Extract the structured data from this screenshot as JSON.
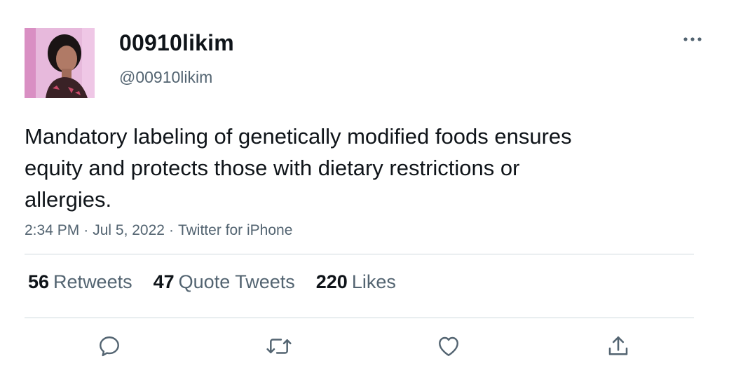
{
  "user": {
    "display_name": "00910likim",
    "handle": "@00910likim"
  },
  "tweet": {
    "text": "Mandatory labeling of genetically modified foods ensures equity and protects those with dietary restrictions or allergies.",
    "time": "2:34 PM",
    "date": "Jul 5, 2022",
    "source": "Twitter for iPhone",
    "separator": "·"
  },
  "stats": {
    "retweets_count": "56",
    "retweets_label": "Retweets",
    "quotes_count": "47",
    "quotes_label": "Quote Tweets",
    "likes_count": "220",
    "likes_label": "Likes"
  },
  "icons": {
    "more": "more-dots-icon",
    "reply": "reply-icon",
    "retweet": "retweet-icon",
    "like": "heart-icon",
    "share": "share-icon"
  },
  "colors": {
    "text_primary": "#0f1419",
    "text_secondary": "#536471",
    "divider": "#cfd9de"
  }
}
